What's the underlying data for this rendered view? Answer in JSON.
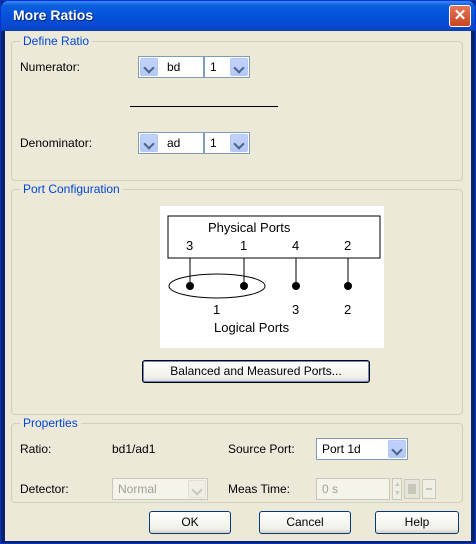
{
  "window": {
    "title": "More Ratios"
  },
  "define_ratio": {
    "title": "Define Ratio",
    "numerator_label": "Numerator:",
    "numerator_port": "bd",
    "numerator_num": "1",
    "denominator_label": "Denominator:",
    "denominator_port": "ad",
    "denominator_num": "1"
  },
  "port_config": {
    "title": "Port Configuration",
    "physical_label": "Physical Ports",
    "logical_label": "Logical Ports",
    "physical_ports": [
      "3",
      "1",
      "4",
      "2"
    ],
    "logical_ports": [
      "1",
      "3",
      "2"
    ],
    "button_label": "Balanced and Measured Ports..."
  },
  "properties": {
    "title": "Properties",
    "ratio_label": "Ratio:",
    "ratio_value": "bd1/ad1",
    "source_port_label": "Source Port:",
    "source_port_value": "Port 1d",
    "detector_label": "Detector:",
    "detector_value": "Normal",
    "meas_time_label": "Meas Time:",
    "meas_time_value": "0 s"
  },
  "footer": {
    "ok": "OK",
    "cancel": "Cancel",
    "help": "Help"
  },
  "colors": {
    "title_bar": "#0652d9",
    "group_title": "#0046d5",
    "dialog_bg": "#ece9d8"
  }
}
